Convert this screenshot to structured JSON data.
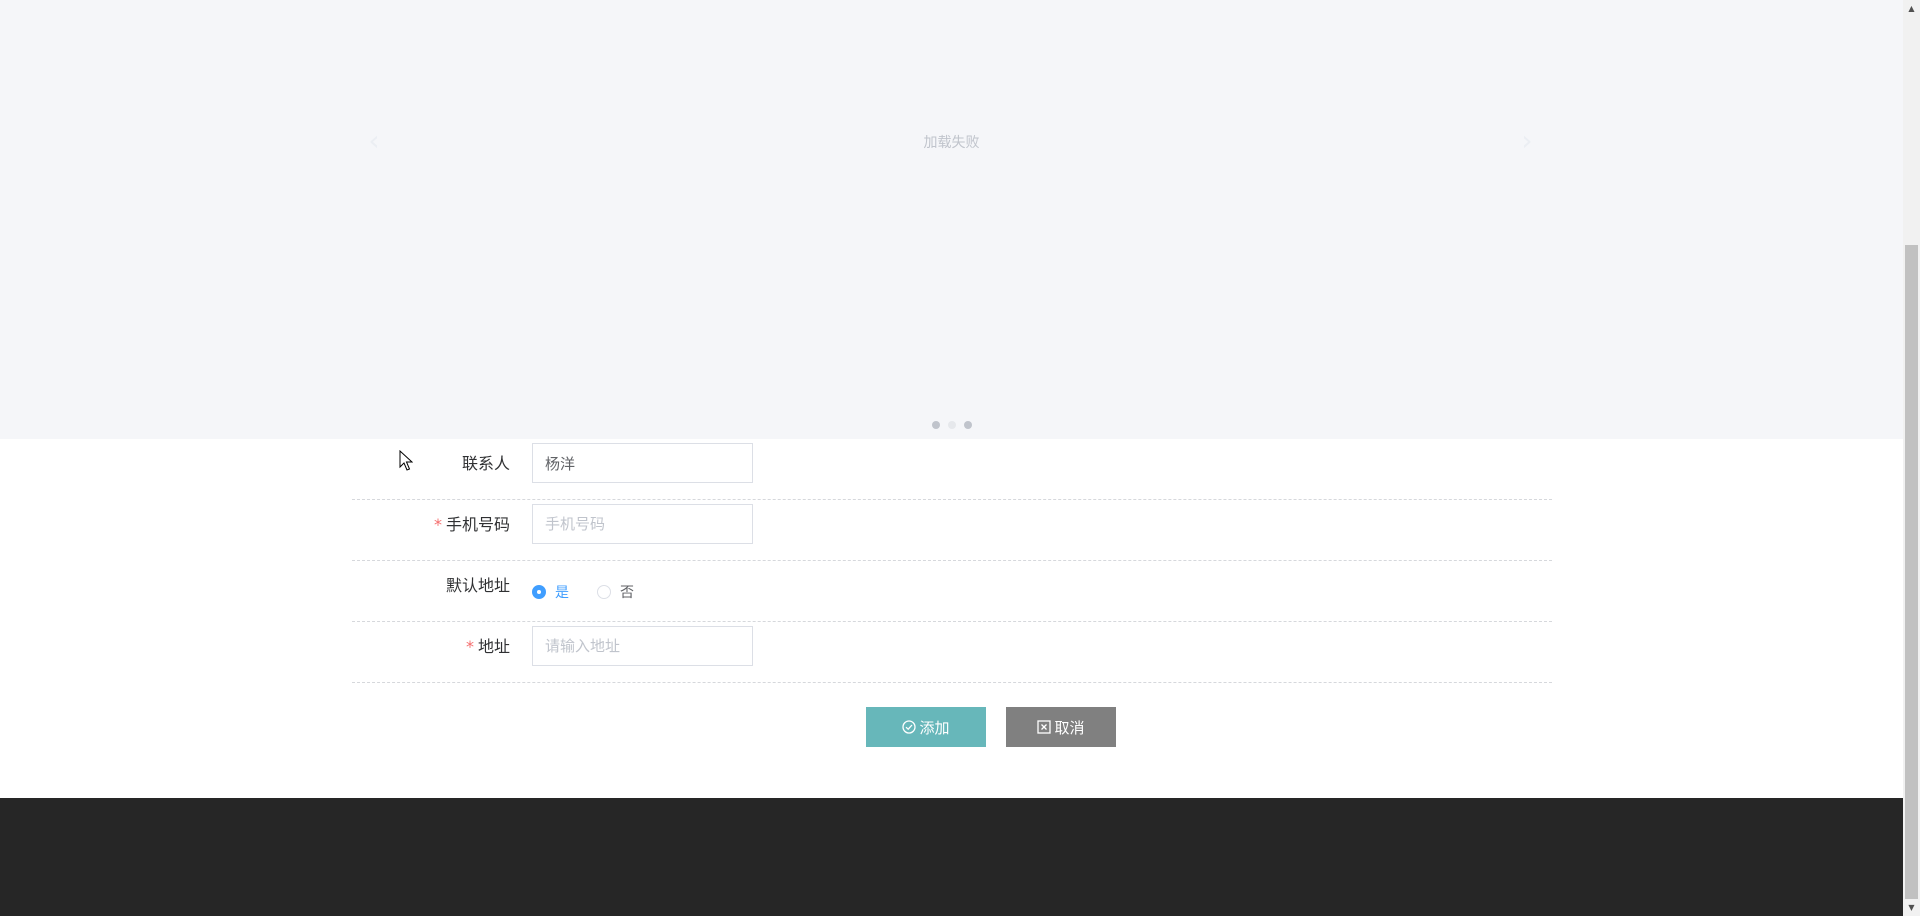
{
  "carousel": {
    "error_text": "加载失败",
    "prev_arrow": "‹",
    "next_arrow": "›",
    "dots": 3,
    "active_dot": 1
  },
  "form": {
    "contact": {
      "label": "联系人",
      "value": "杨洋"
    },
    "phone": {
      "label": "手机号码",
      "placeholder": "手机号码",
      "required_mark": "*"
    },
    "default_address": {
      "label": "默认地址",
      "options": [
        {
          "label": "是",
          "checked": true
        },
        {
          "label": "否",
          "checked": false
        }
      ]
    },
    "address": {
      "label": "地址",
      "placeholder": "请输入地址",
      "required_mark": "*"
    }
  },
  "buttons": {
    "add_label": "添加",
    "add_icon": "check-circle-icon",
    "cancel_label": "取消",
    "cancel_icon": "close-square-icon"
  },
  "colors": {
    "carousel_bg": "#f5f6f9",
    "add_button": "#67b7ba",
    "cancel_button": "#808080",
    "footer": "#262626",
    "radio_active": "#409eff",
    "required": "#f56c6c"
  },
  "scrollbar": {
    "up": "▲",
    "down": "▼"
  }
}
